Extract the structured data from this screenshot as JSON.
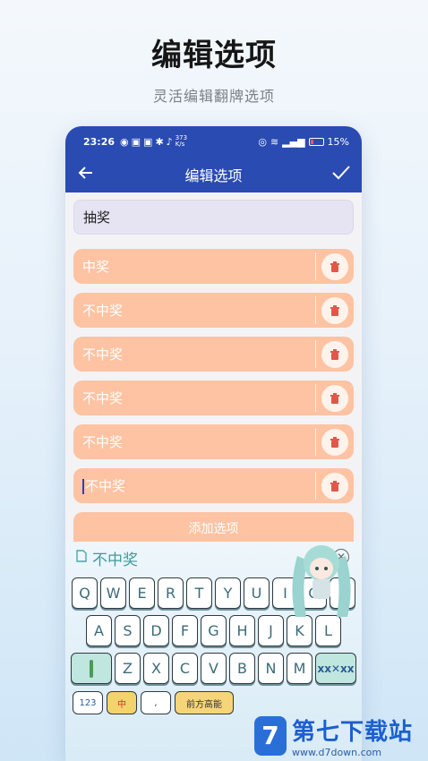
{
  "promo": {
    "title": "编辑选项",
    "subtitle": "灵活编辑翻牌选项"
  },
  "status_bar": {
    "time": "23:26",
    "net_speed_top": "373",
    "net_speed_bottom": "K/s",
    "battery": "15%"
  },
  "app_bar": {
    "title": "编辑选项",
    "back_icon": "arrow-left-icon",
    "confirm_icon": "check-icon"
  },
  "title_field": {
    "value": "抽奖"
  },
  "options": [
    {
      "label": "中奖"
    },
    {
      "label": "不中奖"
    },
    {
      "label": "不中奖"
    },
    {
      "label": "不中奖"
    },
    {
      "label": "不中奖"
    },
    {
      "label": "不中奖"
    }
  ],
  "add_button": {
    "label": "添加选项"
  },
  "keyboard": {
    "suggestion": "不中奖",
    "row1": [
      "Q",
      "W",
      "E",
      "R",
      "T",
      "Y",
      "U",
      "I",
      "O",
      "P"
    ],
    "row2": [
      "A",
      "S",
      "D",
      "F",
      "G",
      "H",
      "J",
      "K",
      "L"
    ],
    "row3": [
      "Z",
      "X",
      "C",
      "V",
      "B",
      "N",
      "M"
    ],
    "bottom_keys": [
      "中",
      "前方高能"
    ]
  },
  "watermark": {
    "brand": "第七下载站",
    "url": "www.d7down.com"
  },
  "colors": {
    "primary": "#2a4bb2",
    "option_bg": "#fdc3a2",
    "title_bg": "#e6e4f3",
    "delete_icon": "#e0584a"
  }
}
